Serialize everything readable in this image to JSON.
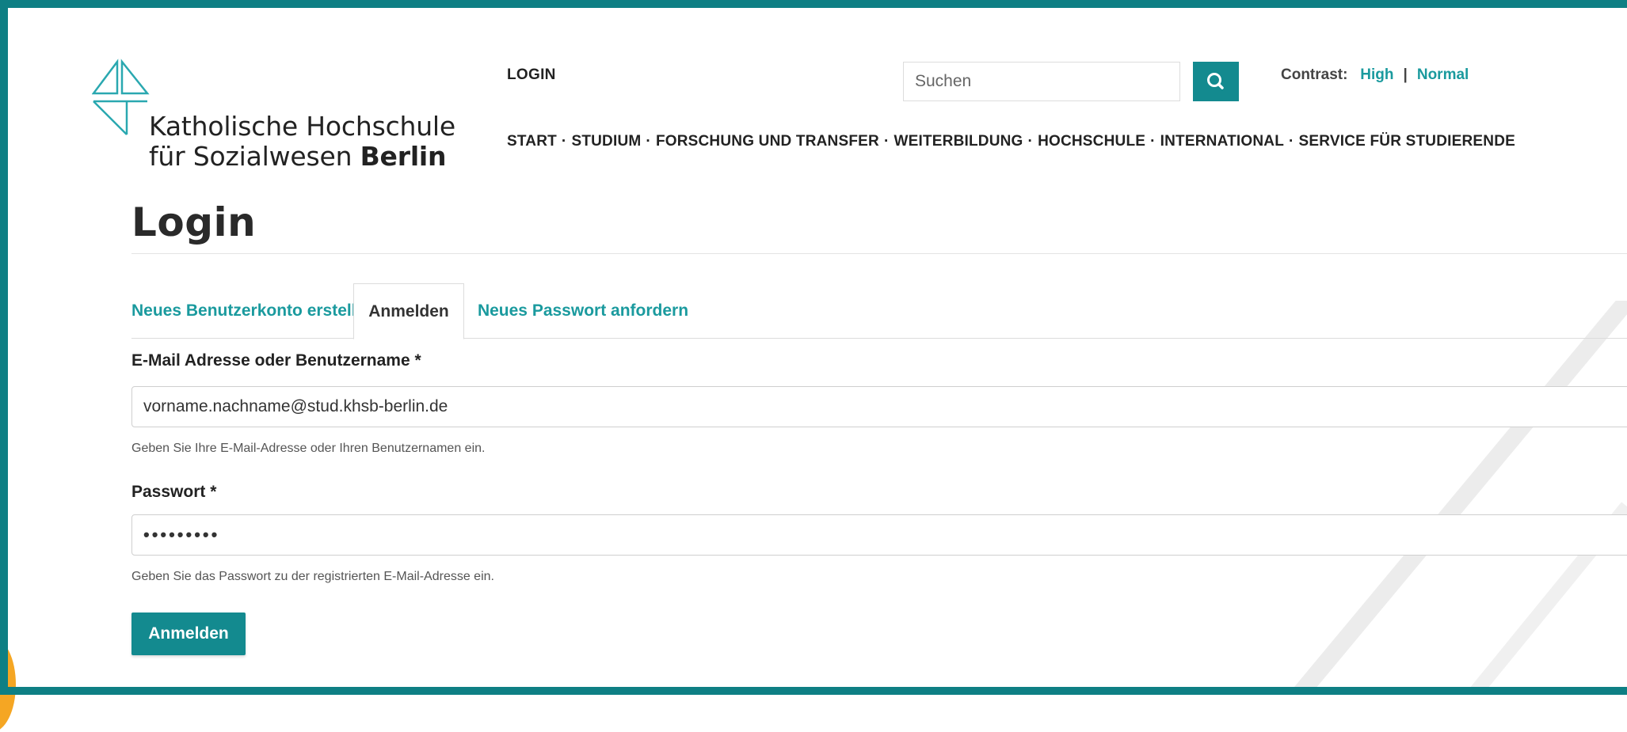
{
  "header": {
    "logo": {
      "line1": "Katholische Hochschule",
      "line2_prefix": "für Sozialwesen ",
      "line2_bold": "Berlin"
    },
    "login_link": "LOGIN",
    "search": {
      "placeholder": "Suchen",
      "value": ""
    },
    "contrast": {
      "label": "Contrast:",
      "high": "High",
      "separator": "|",
      "normal": "Normal"
    },
    "nav": [
      "START",
      "STUDIUM",
      "FORSCHUNG UND TRANSFER",
      "WEITERBILDUNG",
      "HOCHSCHULE",
      "INTERNATIONAL",
      "SERVICE FÜR STUDIERENDE"
    ],
    "nav_separator": "·"
  },
  "page": {
    "title": "Login",
    "tabs": [
      {
        "label": "Neues Benutzerkonto erstellen",
        "active": false
      },
      {
        "label": "Anmelden",
        "active": true
      },
      {
        "label": "Neues Passwort anfordern",
        "active": false
      }
    ]
  },
  "form": {
    "username": {
      "label": "E-Mail Adresse oder Benutzername *",
      "value": "vorname.nachname@stud.khsb-berlin.de",
      "hint": "Geben Sie Ihre E-Mail-Adresse oder Ihren Benutzernamen ein."
    },
    "password": {
      "label": "Passwort *",
      "value": "•••••••••",
      "hint": "Geben Sie das Passwort zu der registrierten E-Mail-Adresse ein."
    },
    "submit_label": "Anmelden"
  },
  "colors": {
    "accent": "#138a8f",
    "link": "#1a9a9e",
    "frame": "#0e7f84"
  }
}
